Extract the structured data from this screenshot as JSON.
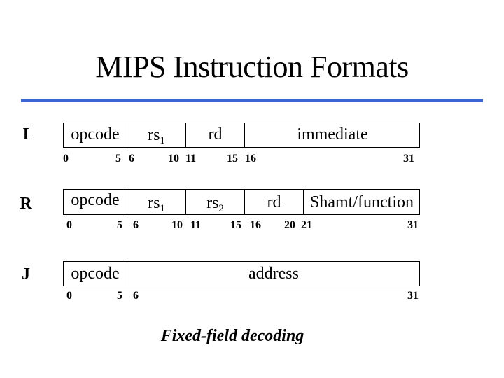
{
  "title": "MIPS Instruction Formats",
  "accent_color": "#3a66d8",
  "formats": {
    "I": {
      "label": "I",
      "fields": [
        {
          "name": "opcode",
          "sub": ""
        },
        {
          "name": "rs",
          "sub": "1"
        },
        {
          "name": "rd",
          "sub": ""
        },
        {
          "name": "immediate",
          "sub": ""
        }
      ],
      "bits": [
        "0",
        "5",
        "6",
        "10",
        "11",
        "15",
        "16",
        "31"
      ]
    },
    "R": {
      "label": "R",
      "fields": [
        {
          "name": "opcode",
          "sub": ""
        },
        {
          "name": "rs",
          "sub": "1"
        },
        {
          "name": "rs",
          "sub": "2"
        },
        {
          "name": "rd",
          "sub": ""
        },
        {
          "name": "Shamt/function",
          "sub": ""
        }
      ],
      "bits": [
        "0",
        "5",
        "6",
        "10",
        "11",
        "15",
        "16",
        "20",
        "21",
        "31"
      ]
    },
    "J": {
      "label": "J",
      "fields": [
        {
          "name": "opcode",
          "sub": ""
        },
        {
          "name": "address",
          "sub": ""
        }
      ],
      "bits": [
        "0",
        "5",
        "6",
        "31"
      ]
    }
  },
  "caption": "Fixed-field decoding"
}
